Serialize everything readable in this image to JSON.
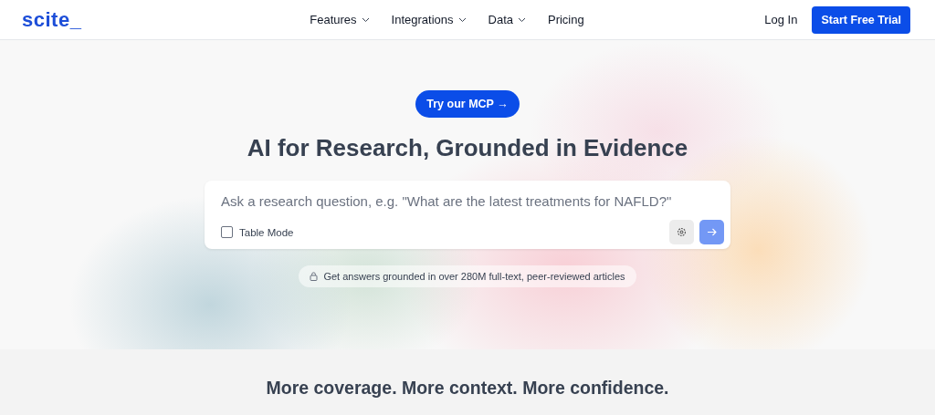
{
  "header": {
    "logo": "scite_",
    "nav": [
      {
        "label": "Features",
        "dropdown": true
      },
      {
        "label": "Integrations",
        "dropdown": true
      },
      {
        "label": "Data",
        "dropdown": true
      },
      {
        "label": "Pricing",
        "dropdown": false
      }
    ],
    "login": "Log In",
    "cta": "Start Free Trial"
  },
  "hero": {
    "badge": "Try our MCP →",
    "title": "AI for Research, Grounded in Evidence",
    "search": {
      "placeholder": "Ask a research question, e.g. \"What are the latest treatments for NAFLD?\"",
      "table_mode": {
        "label": "Table Mode",
        "checked": false
      }
    },
    "note": "Get answers grounded in over 280M full-text, peer-reviewed articles"
  },
  "section": {
    "title": "More coverage. More context. More confidence."
  }
}
